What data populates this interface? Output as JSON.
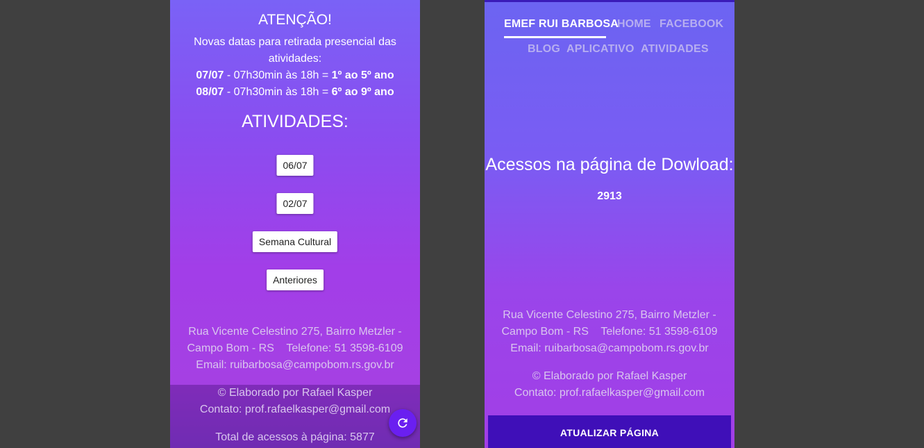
{
  "left": {
    "attention_title": "ATENÇÃO!",
    "notice_line1": "Novas datas para retirada presencial das",
    "notice_line2": "atividades:",
    "schedule": [
      {
        "date": "07/07",
        "time": " - 07h30min às 18h = ",
        "grades": "1º ao 5º ano"
      },
      {
        "date": "08/07",
        "time": " - 07h30min às 18h = ",
        "grades": "6º ao 9º ano"
      }
    ],
    "activities_heading": "ATIVIDADES:",
    "buttons": [
      "06/07",
      "02/07",
      "Semana Cultural",
      "Anteriores"
    ],
    "address_line1": "Rua Vicente Celestino 275, Bairro Metzler -",
    "address_line2": "Campo Bom - RS    Telefone: 51 3598-6109",
    "address_line3": "Email: ruibarbosa@campobom.rs.gov.br",
    "credit_line1": "© Elaborado por Rafael Kasper",
    "credit_line2": "Contato: prof.rafaelkasper@gmail.com",
    "total_access": "Total de acessos à página: 5877",
    "fab_icon": "refresh-icon"
  },
  "right": {
    "nav": {
      "brand": "EMEF RUI BARBOSA",
      "items": [
        "HOME",
        "FACEBOOK",
        "BLOG",
        "APLICATIVO",
        "ATIVIDADES"
      ]
    },
    "download_heading": "Acessos na página de Dowload:",
    "download_count": "2913",
    "address_line1": "Rua Vicente Celestino 275, Bairro Metzler -",
    "address_line2": "Campo Bom - RS    Telefone: 51 3598-6109",
    "address_line3": "Email: ruibarbosa@campobom.rs.gov.br",
    "credit_line1": "© Elaborado por Rafael Kasper",
    "credit_line2": "Contato: prof.rafaelkasper@gmail.com",
    "update_button": "ATUALIZAR PÁGINA"
  },
  "colors": {
    "background": "#404040",
    "fab": "#6a1ff0",
    "update_button": "#3f0fb8"
  }
}
